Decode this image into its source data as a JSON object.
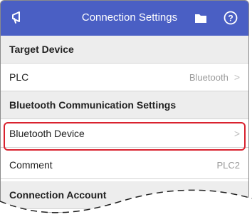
{
  "header": {
    "title": "Connection Settings",
    "icons": [
      "megaphone-icon",
      "folder-icon",
      "help-icon"
    ],
    "color": "#4a5fc4"
  },
  "rows": [
    {
      "type": "section",
      "label": "Target Device"
    },
    {
      "type": "item",
      "label": "PLC",
      "value": "Bluetooth",
      "chevron": ">"
    },
    {
      "type": "section",
      "label": "Bluetooth Communication Settings"
    },
    {
      "type": "item",
      "label": "Bluetooth Device",
      "value": "",
      "chevron": ">"
    },
    {
      "type": "item",
      "label": "Comment",
      "value": "PLC2"
    },
    {
      "type": "section",
      "label": "Connection Account"
    }
  ],
  "highlight_color": "#d9222f"
}
